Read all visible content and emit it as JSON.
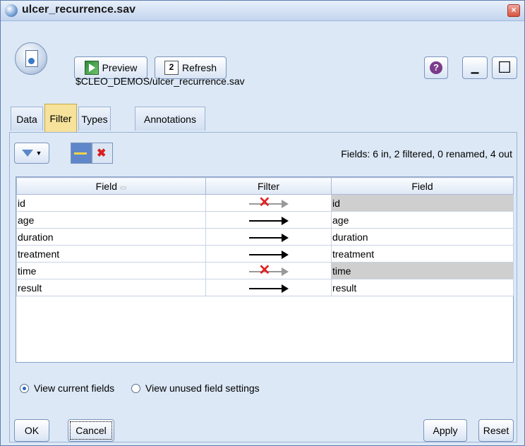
{
  "window": {
    "title": "ulcer_recurrence.sav",
    "close_glyph": "×"
  },
  "toolbar": {
    "preview_label": "Preview",
    "refresh_label": "Refresh",
    "help_glyph": "?",
    "minimize_glyph": "▁",
    "restore_glyph": "☐"
  },
  "source_path": "$CLEO_DEMOS/ulcer_recurrence.sav",
  "tabs": [
    {
      "label": "Data",
      "active": false
    },
    {
      "label": "Filter",
      "active": true
    },
    {
      "label": "Types",
      "active": false
    },
    {
      "label": "Annotations",
      "active": false
    }
  ],
  "filter_panel": {
    "summary": "Fields: 6 in, 2 filtered, 0 renamed, 4 out",
    "columns": {
      "field_in": "Field",
      "sort_glyph": "▭",
      "filter": "Filter",
      "field_out": "Field"
    },
    "rows": [
      {
        "field_in": "id",
        "filtered": true,
        "field_out": "id"
      },
      {
        "field_in": "age",
        "filtered": false,
        "field_out": "age"
      },
      {
        "field_in": "duration",
        "filtered": false,
        "field_out": "duration"
      },
      {
        "field_in": "treatment",
        "filtered": false,
        "field_out": "treatment"
      },
      {
        "field_in": "time",
        "filtered": true,
        "field_out": "time"
      },
      {
        "field_in": "result",
        "filtered": false,
        "field_out": "result"
      }
    ],
    "view_options": {
      "current": "View current fields",
      "unused": "View unused field settings",
      "selected": "current"
    }
  },
  "buttons": {
    "ok": "OK",
    "cancel": "Cancel",
    "apply": "Apply",
    "reset": "Reset"
  },
  "colors": {
    "active_tab": "#f6e29a",
    "filtered_row": "#cfcfcf",
    "remove_x": "#e32020"
  }
}
